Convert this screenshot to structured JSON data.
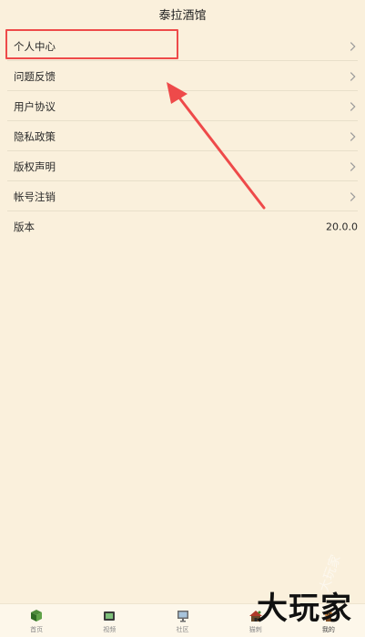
{
  "header": {
    "title": "泰拉酒馆"
  },
  "menu": {
    "items": [
      {
        "label": "个人中心",
        "icon": "chevron-right-icon"
      },
      {
        "label": "问题反馈",
        "icon": "chevron-right-icon"
      },
      {
        "label": "用户协议",
        "icon": "chevron-right-icon"
      },
      {
        "label": "隐私政策",
        "icon": "chevron-right-icon"
      },
      {
        "label": "版权声明",
        "icon": "chevron-right-icon"
      },
      {
        "label": "帐号注销",
        "icon": "chevron-right-icon"
      }
    ],
    "version": {
      "label": "版本",
      "value": "20.0.0"
    }
  },
  "annotation": {
    "color": "#ee4a4a"
  },
  "tabbar": {
    "tabs": [
      {
        "label": "首页",
        "icon": "book-icon"
      },
      {
        "label": "视频",
        "icon": "tv-icon"
      },
      {
        "label": "社区",
        "icon": "monitor-icon"
      },
      {
        "label": "猫刺",
        "icon": "house-icon"
      },
      {
        "label": "我的",
        "icon": "character-icon",
        "active": true
      }
    ]
  },
  "watermark": {
    "text": "大玩家",
    "faint_text": "大玩家"
  },
  "colors": {
    "background": "#faf0dc",
    "divider": "#e8dfca",
    "highlight": "#ee4a4a"
  }
}
